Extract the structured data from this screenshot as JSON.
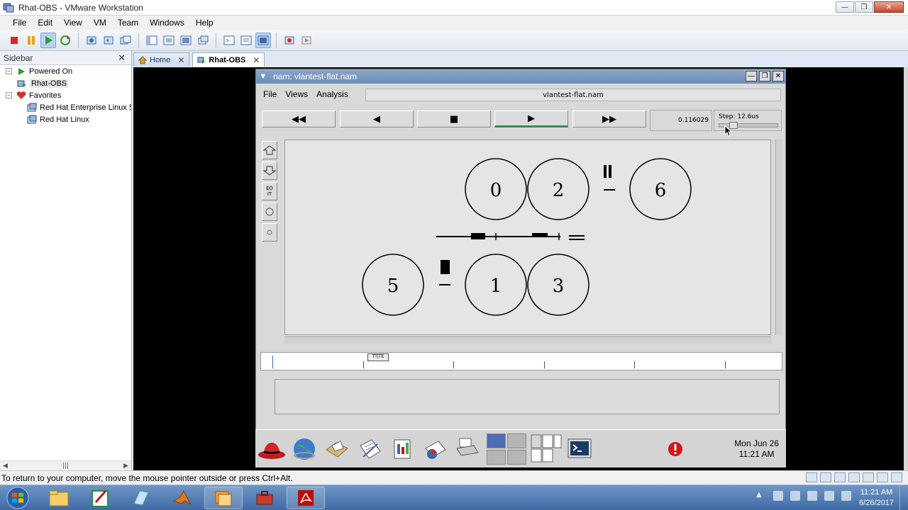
{
  "window": {
    "title": "Rhat-OBS - VMware Workstation"
  },
  "menu": [
    "File",
    "Edit",
    "View",
    "VM",
    "Team",
    "Windows",
    "Help"
  ],
  "sidebar": {
    "title": "Sidebar",
    "groups": [
      {
        "label": "Powered On",
        "items": [
          "Rhat-OBS"
        ]
      },
      {
        "label": "Favorites",
        "items": [
          "Red Hat Enterprise Linux 5",
          "Red Hat Linux"
        ]
      }
    ]
  },
  "tabs": [
    {
      "label": "Home",
      "active": false
    },
    {
      "label": "Rhat-OBS",
      "active": true
    }
  ],
  "nam": {
    "title": "nam: vlantest-flat.nam",
    "menu": [
      "File",
      "Views",
      "Analysis"
    ],
    "filename": "vlantest-flat.nam",
    "controls": {
      "rewind": "◀◀",
      "back": "◀",
      "stop": "■",
      "play": "▶",
      "forward": "▶▶"
    },
    "time": "0.116029",
    "step": "Step: 12.6us",
    "tools": {
      "edit": "ED\nIT"
    },
    "nodes": [
      "0",
      "2",
      "6",
      "5",
      "1",
      "3"
    ],
    "timeline_marker": "TT|TE"
  },
  "panel": {
    "clock_day": "Mon Jun 26",
    "clock_time": "11:21 AM"
  },
  "status": {
    "text": "To return to your computer, move the mouse pointer outside or press Ctrl+Alt."
  },
  "taskbar": {
    "time": "11:21 AM",
    "date": "6/26/2017"
  }
}
